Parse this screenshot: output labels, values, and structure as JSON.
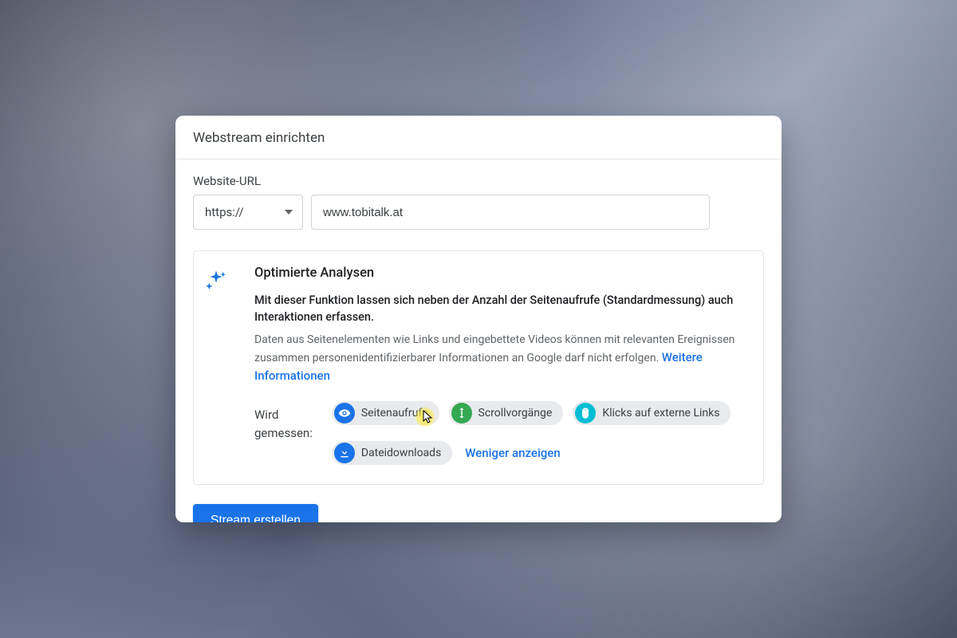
{
  "header": {
    "title": "Webstream einrichten"
  },
  "urlField": {
    "label": "Website-URL",
    "protocol": "https://",
    "value": "www.tobitalk.at"
  },
  "analytics": {
    "title": "Optimierte Analysen",
    "desc1": "Mit dieser Funktion lassen sich neben der Anzahl der Seitenaufrufe (Standardmessung) auch Interaktionen erfassen.",
    "desc2": "Daten aus Seitenelementen wie Links und eingebettete Videos können mit relevanten Ereignissen zusammen personenidentifizierbarer Informationen an Google darf nicht erfolgen.",
    "moreInfo": "Weitere Informationen",
    "measuredLabel": "Wird gemessen:",
    "chips": [
      {
        "label": "Seitenaufrufe",
        "icon": "eye-icon",
        "color": "ci-blue"
      },
      {
        "label": "Scrollvorgänge",
        "icon": "scroll-icon",
        "color": "ci-green"
      },
      {
        "label": "Klicks auf externe Links",
        "icon": "mouse-icon",
        "color": "ci-cyan"
      },
      {
        "label": "Dateidownloads",
        "icon": "download-icon",
        "color": "ci-blue"
      }
    ],
    "toggleLabel": "Weniger anzeigen"
  },
  "actions": {
    "createStream": "Stream erstellen"
  }
}
